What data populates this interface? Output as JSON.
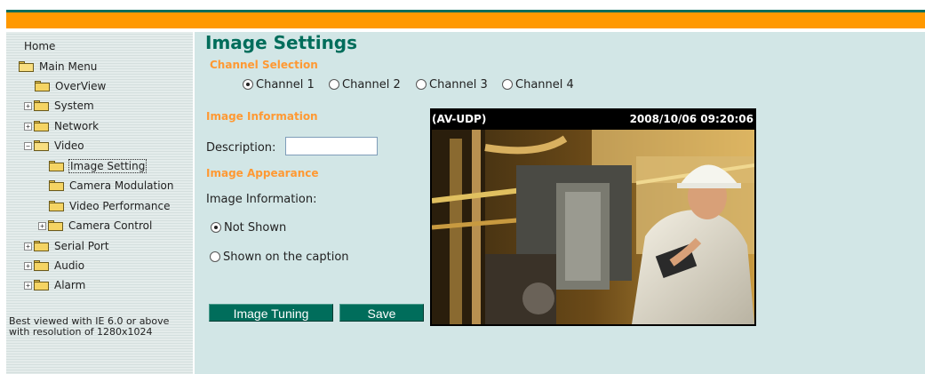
{
  "sidebar": {
    "home": "Home",
    "main_menu": "Main Menu",
    "items": {
      "overview": "OverView",
      "system": "System",
      "network": "Network",
      "video": "Video",
      "image_setting": "Image Setting",
      "camera_modulation": "Camera Modulation",
      "video_performance": "Video Performance",
      "camera_control": "Camera Control",
      "serial_port": "Serial Port",
      "audio": "Audio",
      "alarm": "Alarm"
    },
    "expander_plus": "+",
    "expander_minus": "−",
    "note": "Best viewed with IE 6.0 or above with resolution of 1280x1024"
  },
  "main": {
    "title": "Image Settings",
    "channel_selection": {
      "heading": "Channel Selection",
      "options": [
        "Channel 1",
        "Channel 2",
        "Channel 3",
        "Channel 4"
      ],
      "selected": "Channel 1"
    },
    "image_information": {
      "heading": "Image Information",
      "description_label": "Description:",
      "description_value": ""
    },
    "image_appearance": {
      "heading": "Image Appearance",
      "info_label": "Image Information:",
      "options": [
        "Not Shown",
        "Shown on the caption"
      ],
      "selected": "Not Shown"
    },
    "buttons": {
      "image_tuning": "Image Tuning",
      "save": "Save"
    },
    "video": {
      "caption_left": "(AV-UDP)",
      "caption_right": "2008/10/06 09:20:06"
    }
  },
  "colors": {
    "brand_green": "#006d5b",
    "accent_orange": "#ff9900",
    "heading_orange": "#ff9933",
    "content_bg": "#d2e6e6"
  }
}
